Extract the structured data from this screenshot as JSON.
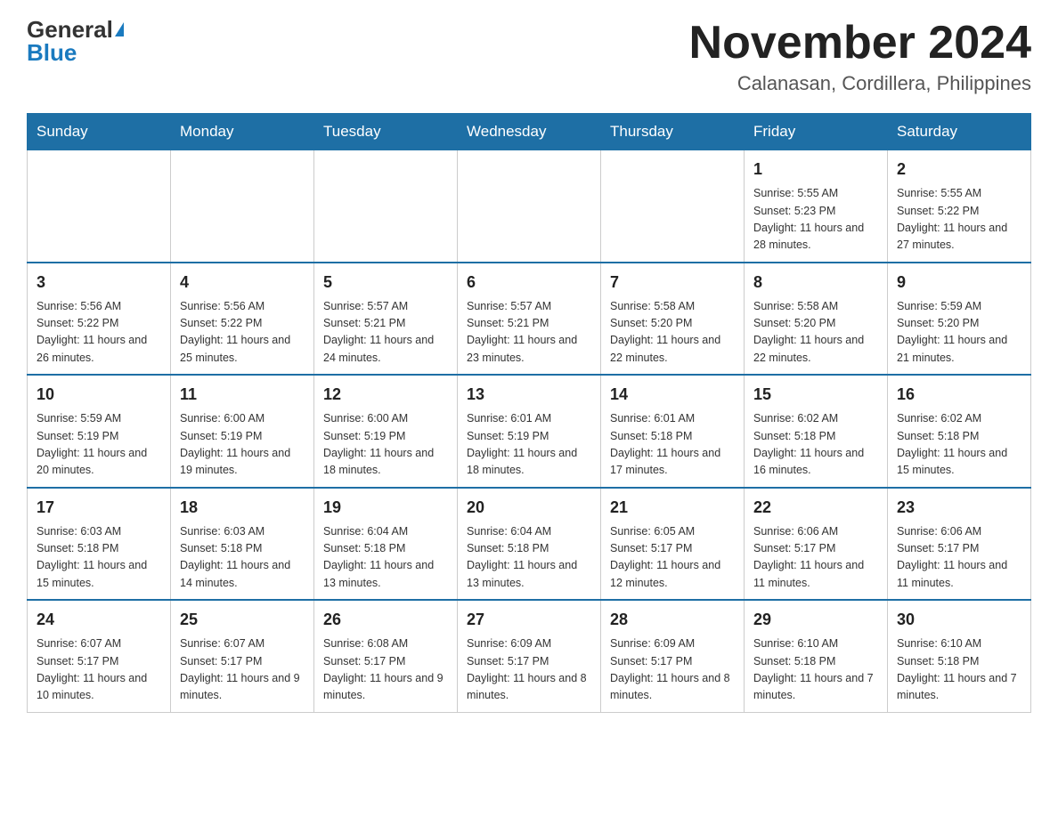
{
  "header": {
    "logo_general": "General",
    "logo_blue": "Blue",
    "month_title": "November 2024",
    "location": "Calanasan, Cordillera, Philippines"
  },
  "weekdays": [
    "Sunday",
    "Monday",
    "Tuesday",
    "Wednesday",
    "Thursday",
    "Friday",
    "Saturday"
  ],
  "weeks": [
    [
      {
        "day": "",
        "info": ""
      },
      {
        "day": "",
        "info": ""
      },
      {
        "day": "",
        "info": ""
      },
      {
        "day": "",
        "info": ""
      },
      {
        "day": "",
        "info": ""
      },
      {
        "day": "1",
        "info": "Sunrise: 5:55 AM\nSunset: 5:23 PM\nDaylight: 11 hours and 28 minutes."
      },
      {
        "day": "2",
        "info": "Sunrise: 5:55 AM\nSunset: 5:22 PM\nDaylight: 11 hours and 27 minutes."
      }
    ],
    [
      {
        "day": "3",
        "info": "Sunrise: 5:56 AM\nSunset: 5:22 PM\nDaylight: 11 hours and 26 minutes."
      },
      {
        "day": "4",
        "info": "Sunrise: 5:56 AM\nSunset: 5:22 PM\nDaylight: 11 hours and 25 minutes."
      },
      {
        "day": "5",
        "info": "Sunrise: 5:57 AM\nSunset: 5:21 PM\nDaylight: 11 hours and 24 minutes."
      },
      {
        "day": "6",
        "info": "Sunrise: 5:57 AM\nSunset: 5:21 PM\nDaylight: 11 hours and 23 minutes."
      },
      {
        "day": "7",
        "info": "Sunrise: 5:58 AM\nSunset: 5:20 PM\nDaylight: 11 hours and 22 minutes."
      },
      {
        "day": "8",
        "info": "Sunrise: 5:58 AM\nSunset: 5:20 PM\nDaylight: 11 hours and 22 minutes."
      },
      {
        "day": "9",
        "info": "Sunrise: 5:59 AM\nSunset: 5:20 PM\nDaylight: 11 hours and 21 minutes."
      }
    ],
    [
      {
        "day": "10",
        "info": "Sunrise: 5:59 AM\nSunset: 5:19 PM\nDaylight: 11 hours and 20 minutes."
      },
      {
        "day": "11",
        "info": "Sunrise: 6:00 AM\nSunset: 5:19 PM\nDaylight: 11 hours and 19 minutes."
      },
      {
        "day": "12",
        "info": "Sunrise: 6:00 AM\nSunset: 5:19 PM\nDaylight: 11 hours and 18 minutes."
      },
      {
        "day": "13",
        "info": "Sunrise: 6:01 AM\nSunset: 5:19 PM\nDaylight: 11 hours and 18 minutes."
      },
      {
        "day": "14",
        "info": "Sunrise: 6:01 AM\nSunset: 5:18 PM\nDaylight: 11 hours and 17 minutes."
      },
      {
        "day": "15",
        "info": "Sunrise: 6:02 AM\nSunset: 5:18 PM\nDaylight: 11 hours and 16 minutes."
      },
      {
        "day": "16",
        "info": "Sunrise: 6:02 AM\nSunset: 5:18 PM\nDaylight: 11 hours and 15 minutes."
      }
    ],
    [
      {
        "day": "17",
        "info": "Sunrise: 6:03 AM\nSunset: 5:18 PM\nDaylight: 11 hours and 15 minutes."
      },
      {
        "day": "18",
        "info": "Sunrise: 6:03 AM\nSunset: 5:18 PM\nDaylight: 11 hours and 14 minutes."
      },
      {
        "day": "19",
        "info": "Sunrise: 6:04 AM\nSunset: 5:18 PM\nDaylight: 11 hours and 13 minutes."
      },
      {
        "day": "20",
        "info": "Sunrise: 6:04 AM\nSunset: 5:18 PM\nDaylight: 11 hours and 13 minutes."
      },
      {
        "day": "21",
        "info": "Sunrise: 6:05 AM\nSunset: 5:17 PM\nDaylight: 11 hours and 12 minutes."
      },
      {
        "day": "22",
        "info": "Sunrise: 6:06 AM\nSunset: 5:17 PM\nDaylight: 11 hours and 11 minutes."
      },
      {
        "day": "23",
        "info": "Sunrise: 6:06 AM\nSunset: 5:17 PM\nDaylight: 11 hours and 11 minutes."
      }
    ],
    [
      {
        "day": "24",
        "info": "Sunrise: 6:07 AM\nSunset: 5:17 PM\nDaylight: 11 hours and 10 minutes."
      },
      {
        "day": "25",
        "info": "Sunrise: 6:07 AM\nSunset: 5:17 PM\nDaylight: 11 hours and 9 minutes."
      },
      {
        "day": "26",
        "info": "Sunrise: 6:08 AM\nSunset: 5:17 PM\nDaylight: 11 hours and 9 minutes."
      },
      {
        "day": "27",
        "info": "Sunrise: 6:09 AM\nSunset: 5:17 PM\nDaylight: 11 hours and 8 minutes."
      },
      {
        "day": "28",
        "info": "Sunrise: 6:09 AM\nSunset: 5:17 PM\nDaylight: 11 hours and 8 minutes."
      },
      {
        "day": "29",
        "info": "Sunrise: 6:10 AM\nSunset: 5:18 PM\nDaylight: 11 hours and 7 minutes."
      },
      {
        "day": "30",
        "info": "Sunrise: 6:10 AM\nSunset: 5:18 PM\nDaylight: 11 hours and 7 minutes."
      }
    ]
  ]
}
